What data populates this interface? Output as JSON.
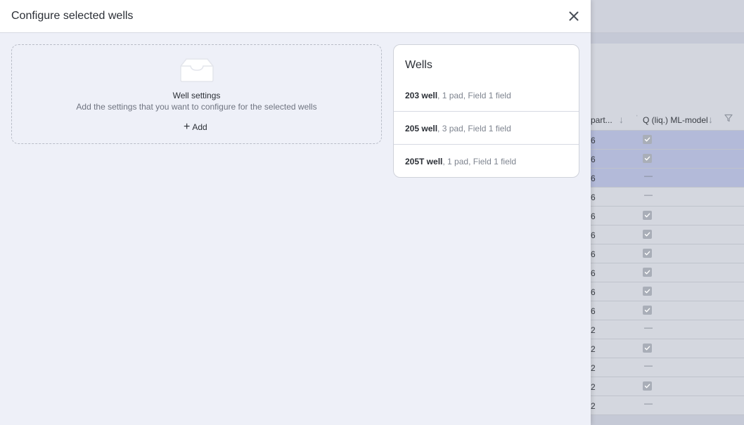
{
  "modal": {
    "title": "Configure selected wells",
    "settings": {
      "title": "Well settings",
      "description": "Add the settings that you want to configure for the selected wells",
      "add_label": "Add"
    },
    "wells": {
      "title": "Wells",
      "items": [
        {
          "name": "203 well",
          "detail": ", 1 pad, Field 1 field"
        },
        {
          "name": "205 well",
          "detail": ", 3 pad, Field 1 field"
        },
        {
          "name": "205T well",
          "detail": ", 1 pad, Field 1 field"
        }
      ]
    }
  },
  "background_table": {
    "col1_header": "part...",
    "col2_header": "Q (liq.) ML-model",
    "rows": [
      {
        "c1": "6",
        "checked": true,
        "selected": true
      },
      {
        "c1": "6",
        "checked": true,
        "selected": true
      },
      {
        "c1": "6",
        "checked": false,
        "selected": true
      },
      {
        "c1": "6",
        "checked": false,
        "selected": false
      },
      {
        "c1": "6",
        "checked": true,
        "selected": false
      },
      {
        "c1": "6",
        "checked": true,
        "selected": false
      },
      {
        "c1": "6",
        "checked": true,
        "selected": false
      },
      {
        "c1": "6",
        "checked": true,
        "selected": false
      },
      {
        "c1": "6",
        "checked": true,
        "selected": false
      },
      {
        "c1": "6",
        "checked": true,
        "selected": false
      },
      {
        "c1": "2",
        "checked": false,
        "selected": false
      },
      {
        "c1": "2",
        "checked": true,
        "selected": false
      },
      {
        "c1": "2",
        "checked": false,
        "selected": false
      },
      {
        "c1": "2",
        "checked": true,
        "selected": false
      },
      {
        "c1": "2",
        "checked": false,
        "selected": false
      }
    ],
    "unchecked_symbol": "—"
  },
  "icons": {
    "close": "close-icon",
    "tray": "inbox-tray-icon",
    "add": "plus-icon",
    "sort": "arrow-down-icon",
    "filter": "filter-icon",
    "checkbox": "checkbox-checked-icon"
  },
  "colors": {
    "panel_bg": "#eef0f8",
    "selected_row": "#b3bad9",
    "text": "#2b2f36"
  }
}
